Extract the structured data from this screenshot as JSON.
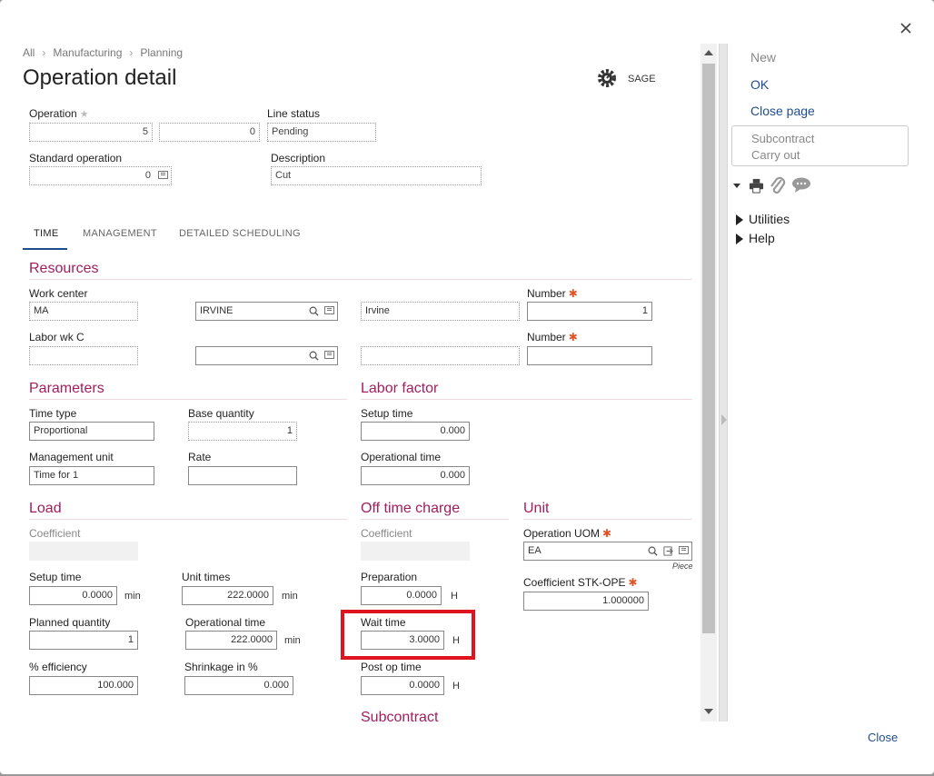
{
  "breadcrumb": [
    "All",
    "Manufacturing",
    "Planning"
  ],
  "page_title": "Operation detail",
  "sage_label": "SAGE",
  "header": {
    "operation_label": "Operation",
    "operation_value": "5",
    "operation_sub_value": "0",
    "line_status_label": "Line status",
    "line_status_value": "Pending",
    "standard_operation_label": "Standard operation",
    "standard_operation_value": "0",
    "description_label": "Description",
    "description_value": "Cut"
  },
  "tabs": [
    "TIME",
    "MANAGEMENT",
    "DETAILED SCHEDULING"
  ],
  "resources": {
    "title": "Resources",
    "work_center_label": "Work center",
    "work_center_value": "MA",
    "work_center_code": "IRVINE",
    "work_center_desc": "Irvine",
    "number_label": "Number",
    "number_value": "1",
    "labor_label": "Labor wk C",
    "labor_value": "",
    "labor_code": "",
    "labor_desc": "",
    "number2_label": "Number",
    "number2_value": ""
  },
  "parameters": {
    "title": "Parameters",
    "time_type_label": "Time type",
    "time_type_value": "Proportional",
    "base_quantity_label": "Base quantity",
    "base_quantity_value": "1",
    "management_unit_label": "Management unit",
    "management_unit_value": "Time for 1",
    "rate_label": "Rate",
    "rate_value": ""
  },
  "labor_factor": {
    "title": "Labor factor",
    "setup_time_label": "Setup time",
    "setup_time_value": "0.000",
    "operational_time_label": "Operational time",
    "operational_time_value": "0.000"
  },
  "load": {
    "title": "Load",
    "coefficient_label": "Coefficient",
    "setup_time_label": "Setup time",
    "setup_time_value": "0.0000",
    "setup_time_unit": "min",
    "unit_times_label": "Unit times",
    "unit_times_value": "222.0000",
    "unit_times_unit": "min",
    "planned_qty_label": "Planned quantity",
    "planned_qty_value": "1",
    "operational_time_label": "Operational time",
    "operational_time_value": "222.0000",
    "operational_time_unit": "min",
    "efficiency_label": "% efficiency",
    "efficiency_value": "100.000",
    "shrinkage_label": "Shrinkage in %",
    "shrinkage_value": "0.000"
  },
  "off_time": {
    "title": "Off time charge",
    "coefficient_label": "Coefficient",
    "preparation_label": "Preparation",
    "preparation_value": "0.0000",
    "preparation_unit": "H",
    "wait_time_label": "Wait time",
    "wait_time_value": "3.0000",
    "wait_time_unit": "H",
    "post_op_label": "Post op time",
    "post_op_value": "0.0000",
    "post_op_unit": "H"
  },
  "unit_section": {
    "title": "Unit",
    "uom_label": "Operation UOM",
    "uom_value": "EA",
    "uom_desc": "Piece",
    "coef_label": "Coefficient STK-OPE",
    "coef_value": "1.000000"
  },
  "subcontract_title": "Subcontract",
  "right_panel": {
    "new": "New",
    "ok": "OK",
    "close_page": "Close page",
    "subcontract": "Subcontract",
    "carry_out": "Carry out",
    "utilities": "Utilities",
    "help": "Help"
  },
  "footer_close": "Close",
  "colors": {
    "accent": "#a01e5e",
    "link": "#1e4d8c",
    "highlight": "#e0141e",
    "required": "#e0542a"
  }
}
